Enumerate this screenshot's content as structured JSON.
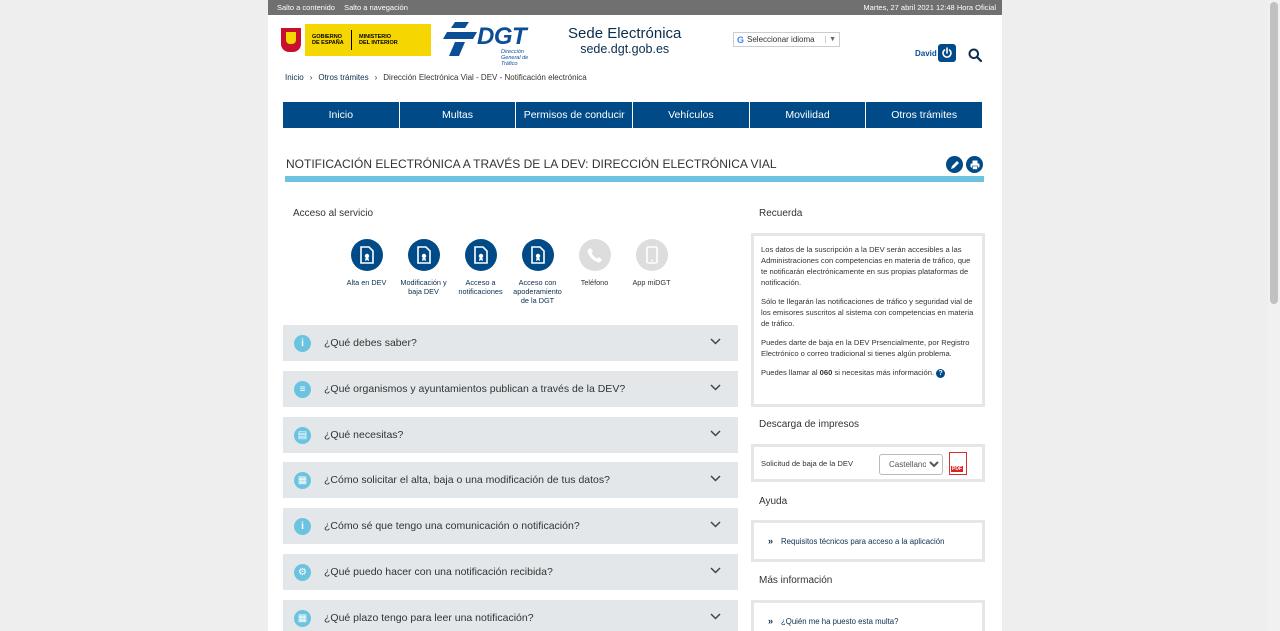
{
  "topbar": {
    "skip_content": "Salto a contenido",
    "skip_nav": "Salto a navegación",
    "datetime": "Martes, 27 abril 2021 12:48 Hora Oficial"
  },
  "header": {
    "gov_line1": "GOBIERNO DE ESPAÑA",
    "gov_line2": "MINISTERIO DEL INTERIOR",
    "dgt_name": "DGT",
    "dgt_sub": "Dirección General de Tráfico",
    "sede_title": "Sede Electrónica",
    "sede_url": "sede.dgt.gob.es",
    "lang_label": "Seleccionar idioma",
    "user_name": "David"
  },
  "breadcrumb": {
    "home": "Inicio",
    "level2": "Otros trámites",
    "current": "Dirección Electrónica Vial - DEV - Notificación electrónica"
  },
  "nav": [
    "Inicio",
    "Multas",
    "Permisos de conducir",
    "Vehículos",
    "Movilidad",
    "Otros trámites"
  ],
  "page_title": "NOTIFICACIÓN ELECTRÓNICA A TRAVÉS DE LA DEV: DIRECCIÓN ELECTRÓNICA VIAL",
  "acceso": {
    "label": "Acceso al servicio",
    "services": [
      {
        "label": "Alta en DEV",
        "enabled": true
      },
      {
        "label": "Modificación y baja DEV",
        "enabled": true
      },
      {
        "label": "Acceso a notificaciones",
        "enabled": true
      },
      {
        "label": "Acceso con apoderamiento de la DGT",
        "enabled": true
      },
      {
        "label": "Teléfono",
        "enabled": false
      },
      {
        "label": "App miDGT",
        "enabled": false
      }
    ]
  },
  "accordion": [
    {
      "label": "¿Qué debes saber?",
      "icon": "info-icon"
    },
    {
      "label": "¿Qué organismos y ayuntamientos publican a través de la DEV?",
      "icon": "list-icon"
    },
    {
      "label": "¿Qué necesitas?",
      "icon": "document-icon"
    },
    {
      "label": "¿Cómo solicitar el alta, baja o una modificación de tus datos?",
      "icon": "calendar-icon"
    },
    {
      "label": "¿Cómo sé que tengo una comunicación o notificación?",
      "icon": "info-icon"
    },
    {
      "label": "¿Qué puedo hacer con una notificación recibida?",
      "icon": "gears-icon"
    },
    {
      "label": "¿Qué plazo tengo para leer una notificación?",
      "icon": "calendar-icon"
    }
  ],
  "sidebar": {
    "recuerda_title": "Recuerda",
    "recuerda_p1": "Los datos de la suscripción a la DEV serán accesibles a las Administraciones con competencias en materia de tráfico, que te notificarán electrónicamente en sus propias plataformas de notificación.",
    "recuerda_p2": "Sólo te llegarán las notificaciones de tráfico y seguridad vial de los emisores suscritos al sistema con competencias en materia de tráfico.",
    "recuerda_p3": "Puedes darte de baja en la DEV Prsencialmente, por Registro Electrónico o correo tradicional si tienes algún problema.",
    "recuerda_p4a": "Puedes llamar al ",
    "recuerda_p4b": "060",
    "recuerda_p4c": " si necesitas más información.",
    "descarga_title": "Descarga de impresos",
    "descarga_item": "Solicitud de baja de la DEV",
    "descarga_select": "Castellano",
    "ayuda_title": "Ayuda",
    "ayuda_link": "Requisitos técnicos para acceso a la aplicación",
    "mas_title": "Más información",
    "mas_link": "¿Quién me ha puesto esta multa?"
  }
}
